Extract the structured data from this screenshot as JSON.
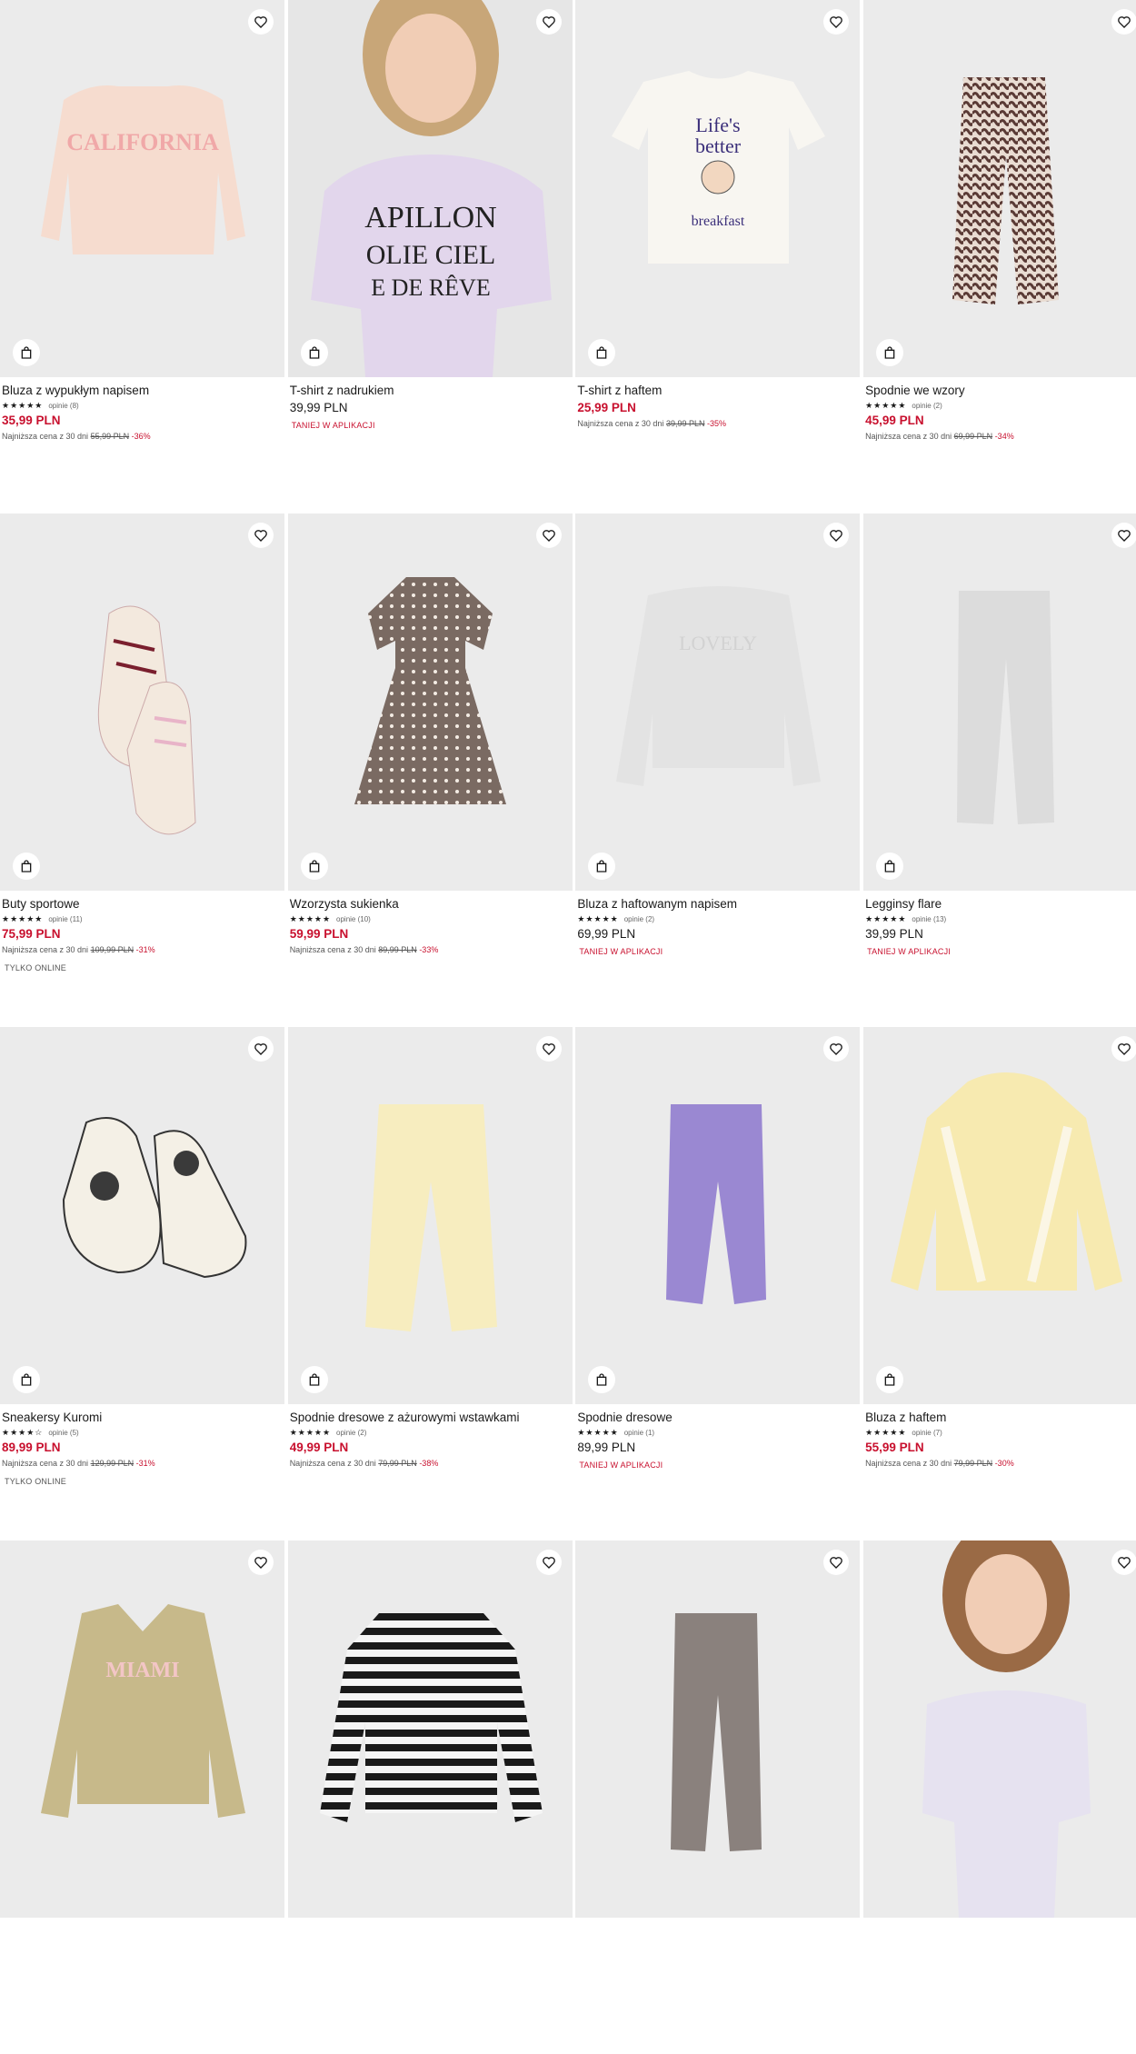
{
  "colors": {
    "sale": "#c8102e",
    "text": "#1a1a1a",
    "image_bg": "#ebebeb"
  },
  "icons": {
    "favorite": "heart-icon",
    "cart": "shopping-bag-icon",
    "star": "star-icon"
  },
  "products": [
    {
      "name": "Bluza z wypukłym napisem",
      "rating": 5,
      "reviews": "opinie (8)",
      "price": "35,99 PLN",
      "sale": true,
      "lowest_label": "Najniższa cena z 30 dni",
      "old_price": "55,99 PLN",
      "discount": "-36%",
      "badge": ""
    },
    {
      "name": "T-shirt z nadrukiem",
      "rating": 0,
      "reviews": "",
      "price": "39,99 PLN",
      "sale": false,
      "lowest_label": "",
      "old_price": "",
      "discount": "",
      "badge": "TANIEJ W APLIKACJI"
    },
    {
      "name": "T-shirt z haftem",
      "rating": 0,
      "reviews": "",
      "price": "25,99 PLN",
      "sale": true,
      "lowest_label": "Najniższa cena z 30 dni",
      "old_price": "39,99 PLN",
      "discount": "-35%",
      "badge": ""
    },
    {
      "name": "Spodnie we wzory",
      "rating": 5,
      "reviews": "opinie (2)",
      "price": "45,99 PLN",
      "sale": true,
      "lowest_label": "Najniższa cena z 30 dni",
      "old_price": "69,99 PLN",
      "discount": "-34%",
      "badge": ""
    },
    {
      "name": "Buty sportowe",
      "rating": 5,
      "reviews": "opinie (11)",
      "price": "75,99 PLN",
      "sale": true,
      "lowest_label": "Najniższa cena z 30 dni",
      "old_price": "109,99 PLN",
      "discount": "-31%",
      "badge": "",
      "online": "TYLKO ONLINE"
    },
    {
      "name": "Wzorzysta sukienka",
      "rating": 5,
      "reviews": "opinie (10)",
      "price": "59,99 PLN",
      "sale": true,
      "lowest_label": "Najniższa cena z 30 dni",
      "old_price": "89,99 PLN",
      "discount": "-33%",
      "badge": ""
    },
    {
      "name": "Bluza z haftowanym napisem",
      "rating": 5,
      "reviews": "opinie (2)",
      "price": "69,99 PLN",
      "sale": false,
      "lowest_label": "",
      "old_price": "",
      "discount": "",
      "badge": "TANIEJ W APLIKACJI"
    },
    {
      "name": "Legginsy flare",
      "rating": 5,
      "reviews": "opinie (13)",
      "price": "39,99 PLN",
      "sale": false,
      "lowest_label": "",
      "old_price": "",
      "discount": "",
      "badge": "TANIEJ W APLIKACJI"
    },
    {
      "name": "Sneakersy Kuromi",
      "rating": 4.5,
      "reviews": "opinie (5)",
      "price": "89,99 PLN",
      "sale": true,
      "lowest_label": "Najniższa cena z 30 dni",
      "old_price": "129,99 PLN",
      "discount": "-31%",
      "badge": "",
      "online": "TYLKO ONLINE"
    },
    {
      "name": "Spodnie dresowe z ażurowymi wstawkami",
      "rating": 5,
      "reviews": "opinie (2)",
      "price": "49,99 PLN",
      "sale": true,
      "lowest_label": "Najniższa cena z 30 dni",
      "old_price": "79,99 PLN",
      "discount": "-38%",
      "badge": ""
    },
    {
      "name": "Spodnie dresowe",
      "rating": 5,
      "reviews": "opinie (1)",
      "price": "89,99 PLN",
      "sale": false,
      "lowest_label": "",
      "old_price": "",
      "discount": "",
      "badge": "TANIEJ W APLIKACJI"
    },
    {
      "name": "Bluza z haftem",
      "rating": 5,
      "reviews": "opinie (7)",
      "price": "55,99 PLN",
      "sale": true,
      "lowest_label": "Najniższa cena z 30 dni",
      "old_price": "79,99 PLN",
      "discount": "-30%",
      "badge": ""
    },
    {
      "name": "",
      "rating": 0,
      "reviews": "",
      "price": "",
      "sale": false,
      "lowest_label": "",
      "old_price": "",
      "discount": "",
      "badge": ""
    },
    {
      "name": "",
      "rating": 0,
      "reviews": "",
      "price": "",
      "sale": false,
      "lowest_label": "",
      "old_price": "",
      "discount": "",
      "badge": ""
    },
    {
      "name": "",
      "rating": 0,
      "reviews": "",
      "price": "",
      "sale": false,
      "lowest_label": "",
      "old_price": "",
      "discount": "",
      "badge": ""
    },
    {
      "name": "",
      "rating": 0,
      "reviews": "",
      "price": "",
      "sale": false,
      "lowest_label": "",
      "old_price": "",
      "discount": "",
      "badge": ""
    }
  ]
}
